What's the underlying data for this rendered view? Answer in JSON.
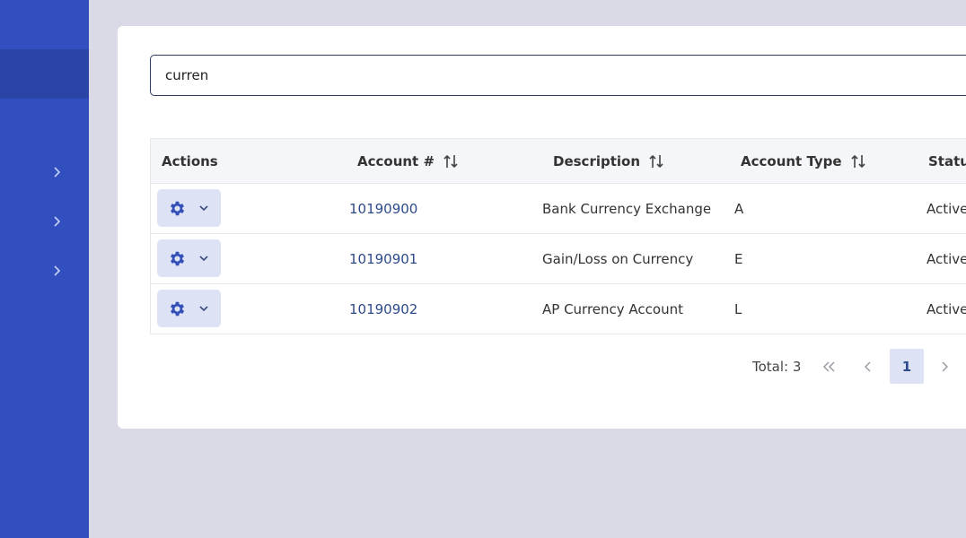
{
  "search": {
    "value": "curren"
  },
  "table": {
    "headers": [
      "Actions",
      "Account #",
      "Description",
      "Account Type",
      "Status"
    ],
    "rows": [
      {
        "account": "10190900",
        "description": "Bank Currency Exchange",
        "type": "A",
        "status": "Active"
      },
      {
        "account": "10190901",
        "description": "Gain/Loss on Currency",
        "type": "E",
        "status": "Active"
      },
      {
        "account": "10190902",
        "description": "AP Currency Account",
        "type": "L",
        "status": "Active"
      }
    ]
  },
  "pagination": {
    "total": "Total: 3",
    "current_page": "1"
  },
  "icons": {
    "gear": "gear-icon",
    "caret": "chevron-down-icon",
    "sort": "sort-icon",
    "first": "double-chevron-left-icon",
    "prev": "chevron-left-icon",
    "next": "chevron-right-icon",
    "expand": "chevron-right-icon"
  },
  "colors": {
    "sidebar": "#324fbf",
    "accent": "#2d4a8a",
    "button_bg": "#dde3f5"
  }
}
